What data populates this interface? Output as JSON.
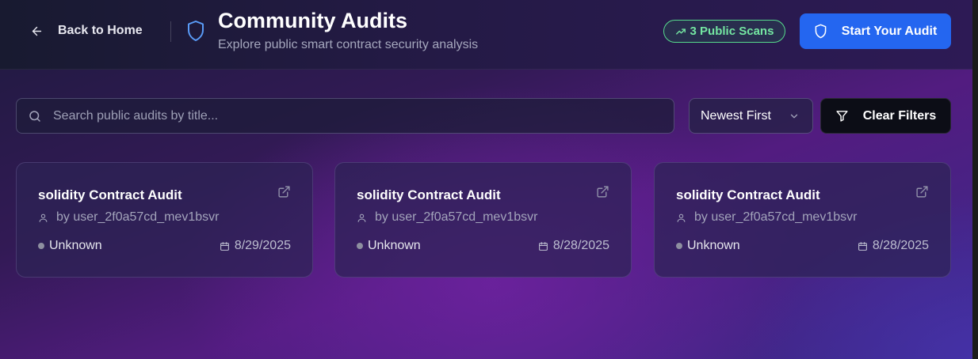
{
  "header": {
    "back_label": "Back to Home",
    "title": "Community Audits",
    "subtitle": "Explore public smart contract security analysis",
    "public_scans_badge": "3 Public Scans",
    "start_audit_label": "Start Your Audit"
  },
  "filters": {
    "search_placeholder": "Search public audits by title...",
    "search_value": "",
    "sort_selected": "Newest First",
    "clear_label": "Clear Filters"
  },
  "audits": [
    {
      "title": "solidity Contract Audit",
      "author": "by user_2f0a57cd_mev1bsvr",
      "status": "Unknown",
      "date": "8/29/2025"
    },
    {
      "title": "solidity Contract Audit",
      "author": "by user_2f0a57cd_mev1bsvr",
      "status": "Unknown",
      "date": "8/28/2025"
    },
    {
      "title": "solidity Contract Audit",
      "author": "by user_2f0a57cd_mev1bsvr",
      "status": "Unknown",
      "date": "8/28/2025"
    }
  ],
  "colors": {
    "accent_blue": "#2466f0",
    "badge_green": "#74e6a2",
    "shield_blue": "#5a9cf8",
    "status_unknown": "#8e8fa0"
  },
  "icons": {
    "back": "arrow-left-icon",
    "title": "shield-icon",
    "badge": "trending-up-icon",
    "start": "shield-icon",
    "search": "search-icon",
    "sort": "chevron-down-icon",
    "clear": "filter-icon",
    "card_link": "external-link-icon",
    "author": "user-icon",
    "date": "calendar-icon"
  }
}
